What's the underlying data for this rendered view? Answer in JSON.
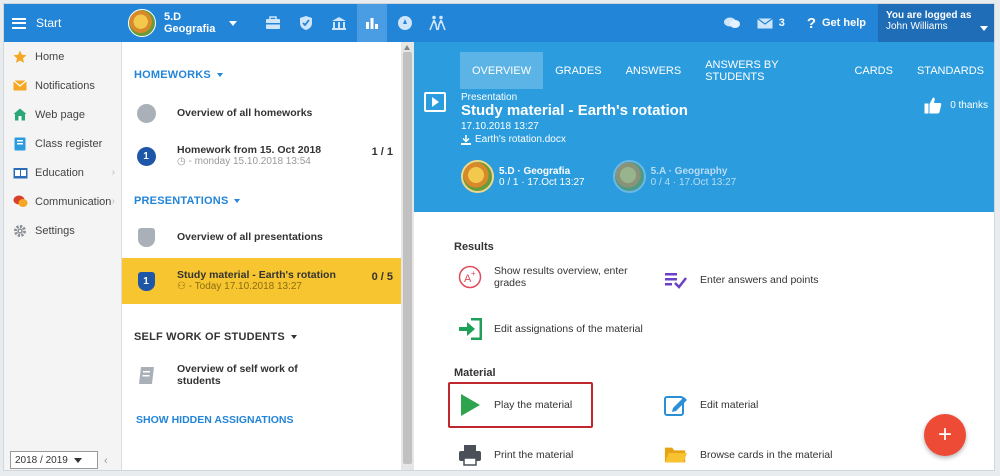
{
  "topbar": {
    "start_label": "Start",
    "class_name": "5.D",
    "class_subject": "Geografia",
    "mail_count": "3",
    "help_label": "Get help",
    "logged_as": "You are logged as",
    "user_name": "John Williams",
    "icons": [
      "briefcase-icon",
      "shield-icon",
      "building-icon",
      "chart-icon",
      "compass-icon",
      "walking-people-icon"
    ]
  },
  "sidebar": {
    "items": [
      {
        "label": "Home",
        "icon": "star-icon"
      },
      {
        "label": "Notifications",
        "icon": "envelope-icon"
      },
      {
        "label": "Web page",
        "icon": "house-icon"
      },
      {
        "label": "Class register",
        "icon": "register-icon"
      },
      {
        "label": "Education",
        "icon": "education-icon"
      },
      {
        "label": "Communication",
        "icon": "communication-icon"
      },
      {
        "label": "Settings",
        "icon": "gear-icon"
      }
    ],
    "year": "2018 / 2019"
  },
  "middle": {
    "homeworks_header": "HOMEWORKS",
    "homework_overview": "Overview of all homeworks",
    "homework_item": {
      "number": "1",
      "title": "Homework from 15. Oct 2018",
      "sub": "- monday 15.10.2018 13:54",
      "count": "1 / 1"
    },
    "presentations_header": "PRESENTATIONS",
    "presentation_overview": "Overview of all presentations",
    "presentation_item": {
      "number": "1",
      "title": "Study material - Earth's rotation",
      "sub": "- Today 17.10.2018 13:27",
      "count": "0 / 5"
    },
    "selfwork_header": "SELF WORK OF STUDENTS",
    "selfwork_overview_line1": "Overview of self work of",
    "selfwork_overview_line2": "students",
    "show_hidden": "SHOW HIDDEN ASSIGNATIONS"
  },
  "detail": {
    "tabs": [
      "OVERVIEW",
      "GRADES",
      "ANSWERS",
      "ANSWERS BY STUDENTS",
      "CARDS",
      "STANDARDS"
    ],
    "type": "Presentation",
    "title": "Study material - Earth's rotation",
    "date": "17.10.2018 13:27",
    "file": "Earth's rotation.docx",
    "thanks": "0 thanks",
    "classes": [
      {
        "name": "5.D · Geografia",
        "stats": "0 / 1 · 17.Oct 13:27"
      },
      {
        "name": "5.A · Geography",
        "stats": "0 / 4 · 17.Oct 13:27"
      }
    ],
    "results_label": "Results",
    "action_results_line1": "Show results overview, enter",
    "action_results_line2": "grades",
    "action_answers": "Enter answers and points",
    "action_assignations": "Edit assignations of the material",
    "material_label": "Material",
    "action_play": "Play the material",
    "action_edit": "Edit material",
    "action_print": "Print the material",
    "action_browse": "Browse cards in the material",
    "fab_label": "+"
  },
  "colors": {
    "topbar": "#2385d8",
    "hero": "#2b9cde",
    "active_row": "#f7c52f",
    "highlight_box": "#c0272d",
    "fab": "#ee4b36"
  }
}
